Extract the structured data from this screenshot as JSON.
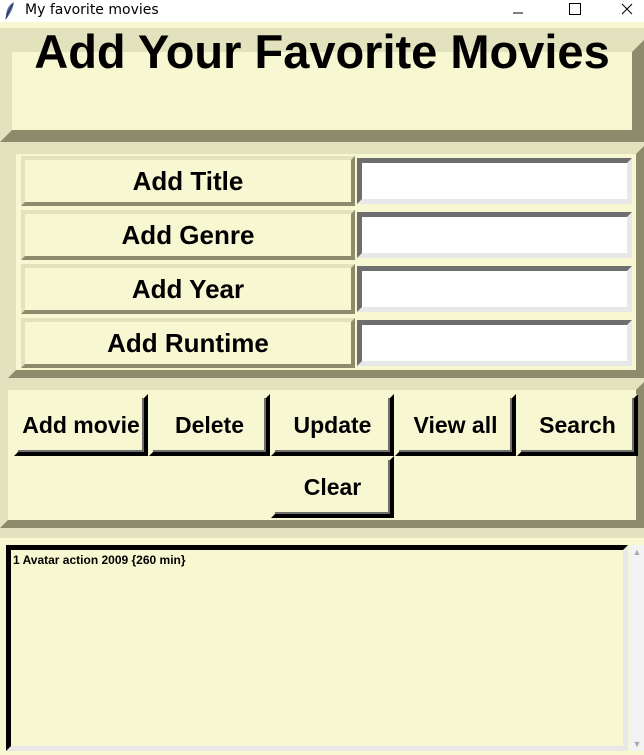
{
  "window": {
    "title": "My favorite movies",
    "icon": "feather-icon",
    "controls": [
      "minimize-icon",
      "maximize-icon",
      "close-icon"
    ]
  },
  "header": {
    "title": "Add Your Favorite Movies"
  },
  "form": {
    "fields": [
      {
        "label": "Add Title",
        "value": ""
      },
      {
        "label": "Add Genre",
        "value": ""
      },
      {
        "label": "Add Year",
        "value": ""
      },
      {
        "label": "Add Runtime",
        "value": ""
      }
    ]
  },
  "buttons": {
    "add": "Add movie",
    "delete": "Delete",
    "update": "Update",
    "view_all": "View all",
    "search": "Search",
    "clear": "Clear"
  },
  "list": {
    "items": [
      "1 Avatar action 2009 {260 min}"
    ]
  },
  "colors": {
    "background": "#f7f7d2",
    "frame": "#e2e2be",
    "frame_shadow": "#8c8c6c"
  }
}
